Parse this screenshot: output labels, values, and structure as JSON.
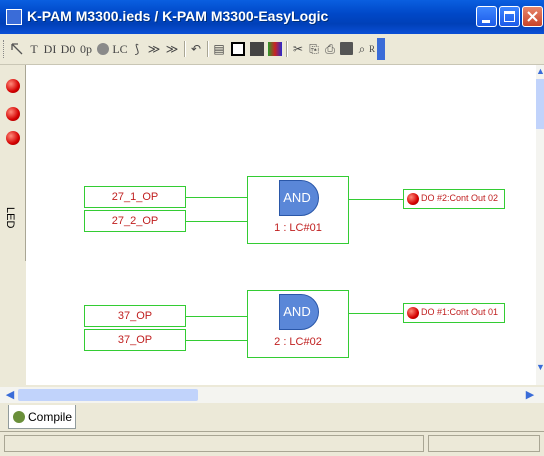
{
  "window": {
    "title": "K-PAM M3300.ieds / K-PAM M3300-EasyLogic"
  },
  "toolbar": {
    "items": [
      "T",
      "DI",
      "D0",
      "0p",
      "LC",
      "⟆",
      "≫",
      "≫",
      "↶",
      "▤",
      "□",
      "█",
      "▋",
      "✂",
      "⎘",
      "⎙",
      "💾",
      "⌕",
      "R",
      "RC"
    ]
  },
  "left_panel": {
    "label": "LED"
  },
  "diagram": {
    "groups": [
      {
        "inputs": [
          "27_1_OP",
          "27_2_OP"
        ],
        "gate_label": "AND",
        "gate_id": "1 : LC#01",
        "output": "DO #2:Cont Out 02"
      },
      {
        "inputs": [
          "37_OP",
          "37_OP"
        ],
        "gate_label": "AND",
        "gate_id": "2 : LC#02",
        "output": "DO #1:Cont Out 01"
      }
    ]
  },
  "bottom_tab": {
    "label": "Compile"
  },
  "colors": {
    "title_bar": "#0048c8",
    "block_border": "#33cc33",
    "label_text": "#c02020",
    "gate_fill": "#5a87d8"
  }
}
